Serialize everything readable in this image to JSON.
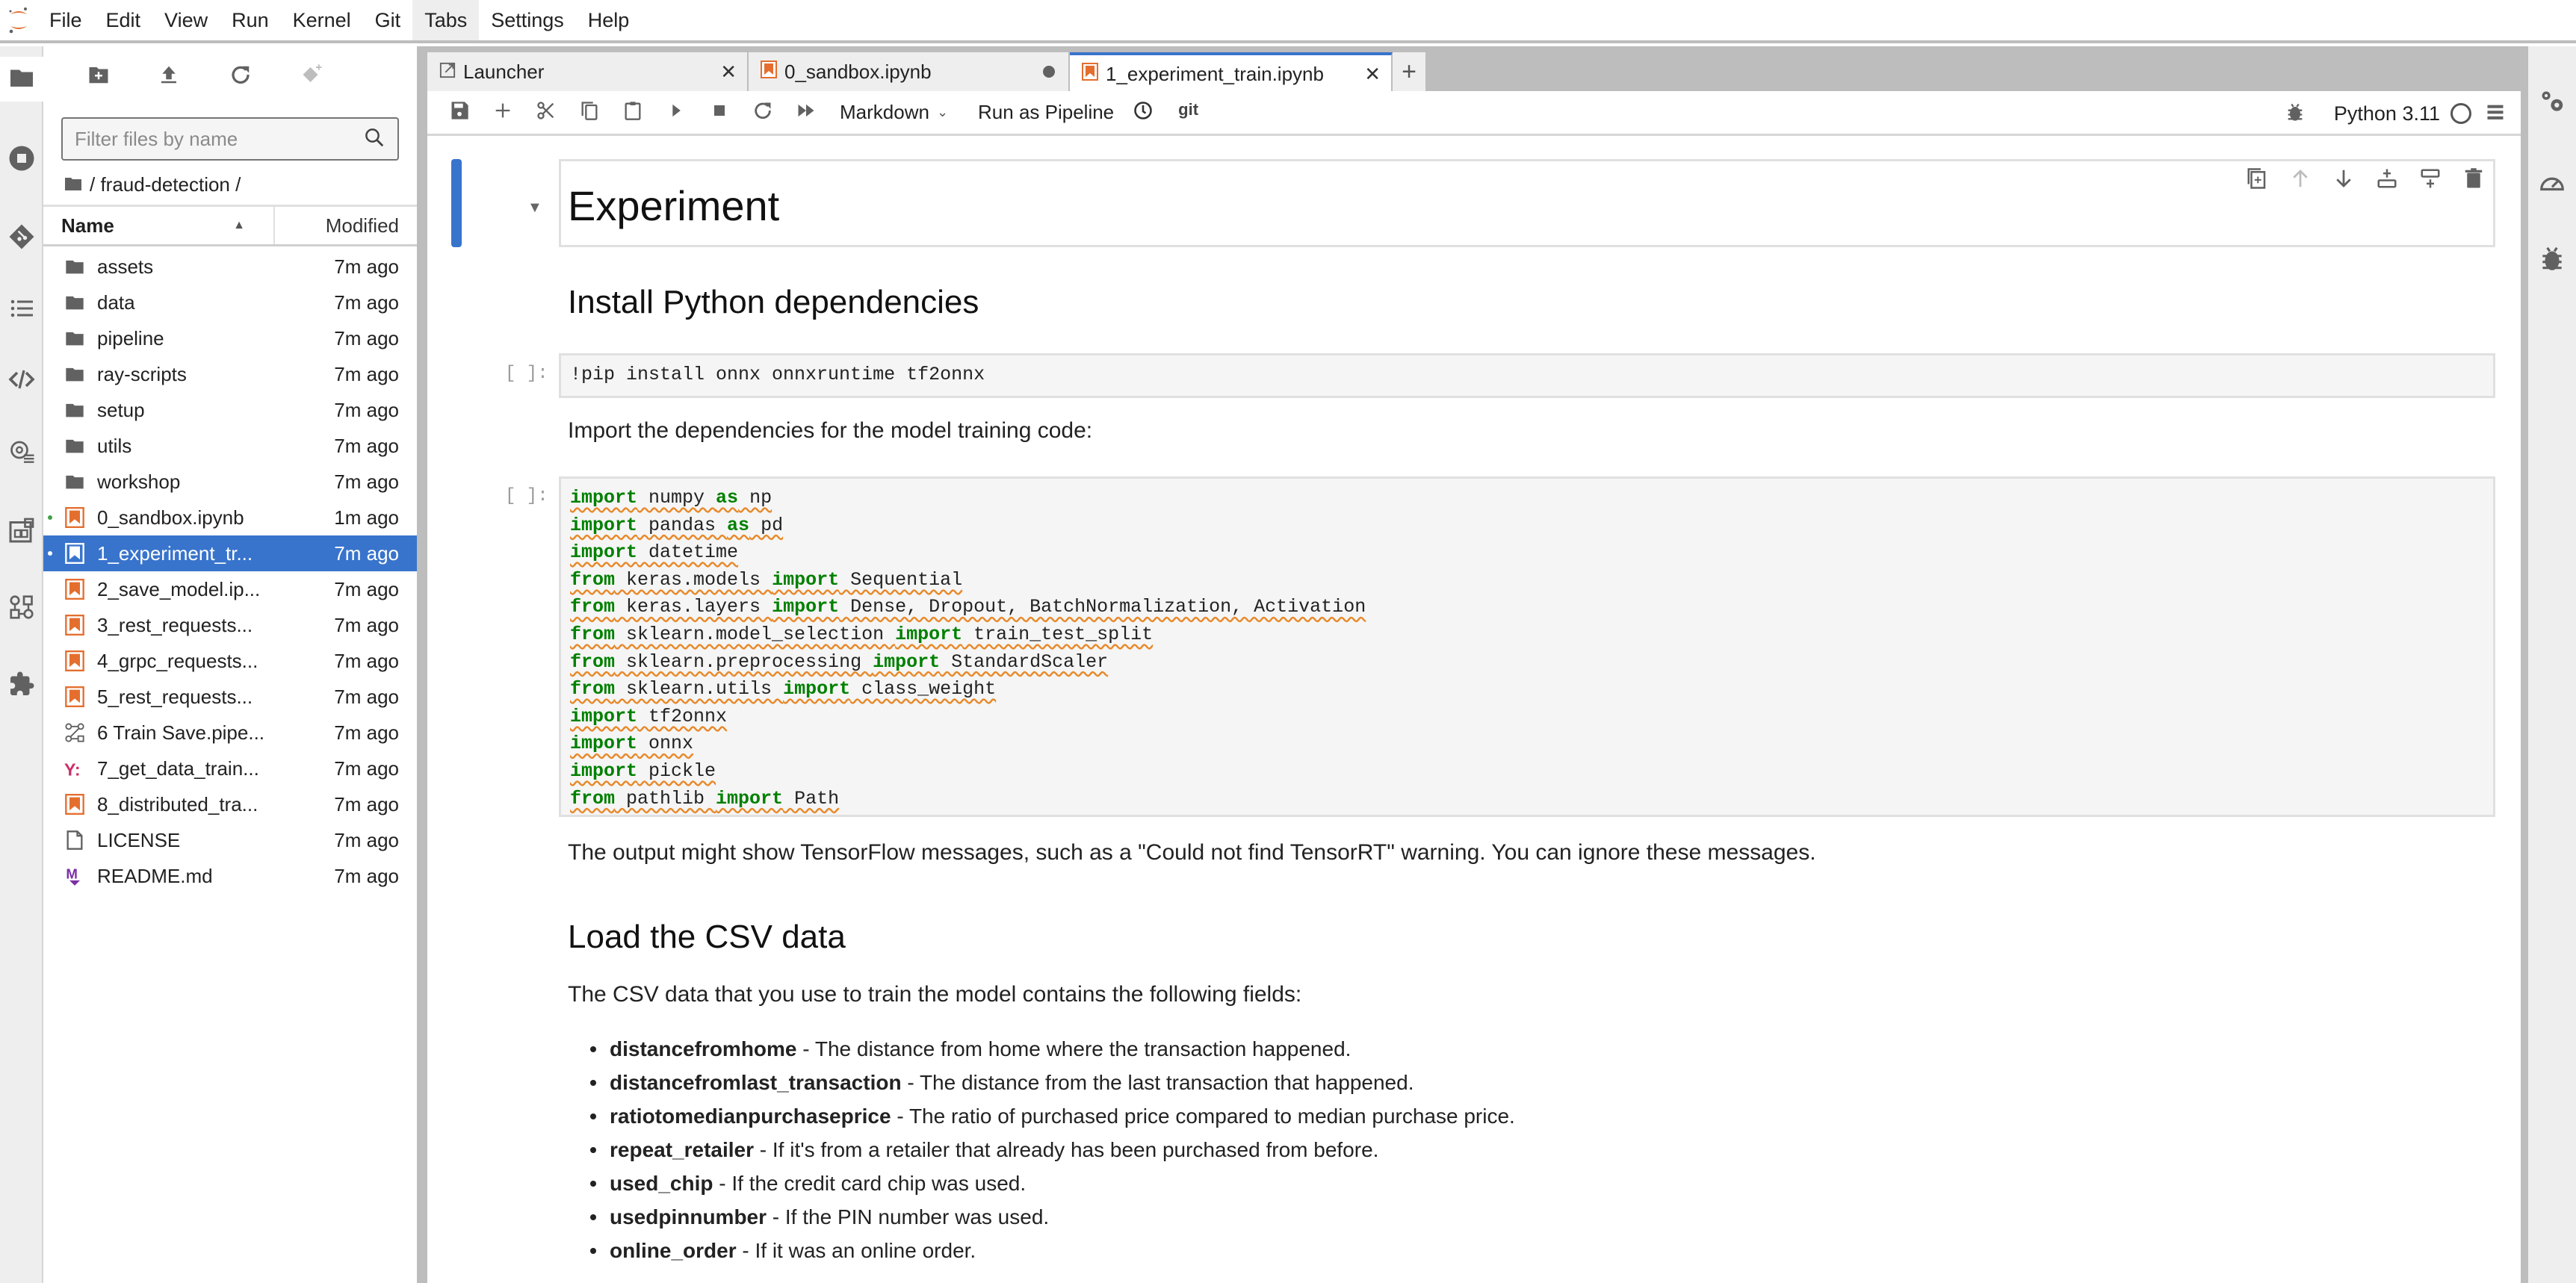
{
  "menubar": {
    "logo": "jupyter-logo",
    "items": [
      "File",
      "Edit",
      "View",
      "Run",
      "Kernel",
      "Git",
      "Tabs",
      "Settings",
      "Help"
    ],
    "active_item": "Tabs"
  },
  "activity_bar": {
    "icons": [
      "folder-icon",
      "running-icon",
      "git-icon",
      "toc-icon",
      "code-snippet-icon",
      "property-inspector-icon",
      "palette-icon",
      "pipeline-icon",
      "extension-icon"
    ]
  },
  "file_browser": {
    "toolbar": [
      "new-folder-icon",
      "upload-icon",
      "refresh-icon",
      "git-clone-icon"
    ],
    "filter_placeholder": "Filter files by name",
    "filter_value": "",
    "breadcrumb": "/ fraud-detection /",
    "columns": {
      "name": "Name",
      "modified": "Modified"
    },
    "files": [
      {
        "name": "assets",
        "type": "folder",
        "modified": "7m ago"
      },
      {
        "name": "data",
        "type": "folder",
        "modified": "7m ago"
      },
      {
        "name": "pipeline",
        "type": "folder",
        "modified": "7m ago"
      },
      {
        "name": "ray-scripts",
        "type": "folder",
        "modified": "7m ago"
      },
      {
        "name": "setup",
        "type": "folder",
        "modified": "7m ago"
      },
      {
        "name": "utils",
        "type": "folder",
        "modified": "7m ago"
      },
      {
        "name": "workshop",
        "type": "folder",
        "modified": "7m ago"
      },
      {
        "name": "0_sandbox.ipynb",
        "type": "notebook",
        "modified": "1m ago",
        "running": true
      },
      {
        "name": "1_experiment_tr...",
        "type": "notebook",
        "modified": "7m ago",
        "running": true,
        "selected": true
      },
      {
        "name": "2_save_model.ip...",
        "type": "notebook",
        "modified": "7m ago"
      },
      {
        "name": "3_rest_requests...",
        "type": "notebook",
        "modified": "7m ago"
      },
      {
        "name": "4_grpc_requests...",
        "type": "notebook",
        "modified": "7m ago"
      },
      {
        "name": "5_rest_requests...",
        "type": "notebook",
        "modified": "7m ago"
      },
      {
        "name": "6 Train Save.pipe...",
        "type": "pipeline",
        "modified": "7m ago"
      },
      {
        "name": "7_get_data_train...",
        "type": "yaml",
        "modified": "7m ago"
      },
      {
        "name": "8_distributed_tra...",
        "type": "notebook",
        "modified": "7m ago"
      },
      {
        "name": "LICENSE",
        "type": "file",
        "modified": "7m ago"
      },
      {
        "name": "README.md",
        "type": "markdown",
        "modified": "7m ago"
      }
    ]
  },
  "tabs": [
    {
      "label": "Launcher",
      "icon": "launcher-icon",
      "state": "close"
    },
    {
      "label": "0_sandbox.ipynb",
      "icon": "notebook-icon",
      "state": "dirty"
    },
    {
      "label": "1_experiment_train.ipynb",
      "icon": "notebook-icon",
      "state": "close",
      "active": true
    }
  ],
  "notebook_toolbar": {
    "cell_type": "Markdown",
    "run_pipeline_label": "Run as Pipeline",
    "git_label": "git",
    "kernel_name": "Python 3.11"
  },
  "notebook": {
    "h1": "Experiment",
    "h2_install": "Install Python dependencies",
    "prompt": "[ ]:",
    "pip_cell": "!pip install onnx onnxruntime tf2onnx",
    "import_text": "Import the dependencies for the model training code:",
    "code_lines": [
      [
        [
          "kw",
          "import"
        ],
        [
          "t",
          " numpy "
        ],
        [
          "kw",
          "as"
        ],
        [
          "t",
          " np"
        ]
      ],
      [
        [
          "kw",
          "import"
        ],
        [
          "t",
          " pandas "
        ],
        [
          "kw",
          "as"
        ],
        [
          "t",
          " pd"
        ]
      ],
      [
        [
          "kw",
          "import"
        ],
        [
          "t",
          " datetime"
        ]
      ],
      [
        [
          "kw",
          "from"
        ],
        [
          "t",
          " keras.models "
        ],
        [
          "kw",
          "import"
        ],
        [
          "t",
          " Sequential"
        ]
      ],
      [
        [
          "kw",
          "from"
        ],
        [
          "t",
          " keras.layers "
        ],
        [
          "kw",
          "import"
        ],
        [
          "t",
          " Dense, Dropout, BatchNormalization, Activation"
        ]
      ],
      [
        [
          "kw",
          "from"
        ],
        [
          "t",
          " sklearn.model_selection "
        ],
        [
          "kw",
          "import"
        ],
        [
          "t",
          " train_test_split"
        ]
      ],
      [
        [
          "kw",
          "from"
        ],
        [
          "t",
          " sklearn.preprocessing "
        ],
        [
          "kw",
          "import"
        ],
        [
          "t",
          " StandardScaler"
        ]
      ],
      [
        [
          "kw",
          "from"
        ],
        [
          "t",
          " sklearn.utils "
        ],
        [
          "kw",
          "import"
        ],
        [
          "t",
          " class_weight"
        ]
      ],
      [
        [
          "kw",
          "import"
        ],
        [
          "t",
          " tf2onnx"
        ]
      ],
      [
        [
          "kw",
          "import"
        ],
        [
          "t",
          " onnx"
        ]
      ],
      [
        [
          "kw",
          "import"
        ],
        [
          "t",
          " pickle"
        ]
      ],
      [
        [
          "kw",
          "from"
        ],
        [
          "t",
          " pathlib "
        ],
        [
          "kw",
          "import"
        ],
        [
          "t",
          " Path"
        ]
      ]
    ],
    "tf_note": "The output might show TensorFlow messages, such as a \"Could not find TensorRT\" warning. You can ignore these messages.",
    "h2_csv": "Load the CSV data",
    "csv_intro": "The CSV data that you use to train the model contains the following fields:",
    "fields": [
      {
        "name": "distancefromhome",
        "desc": " - The distance from home where the transaction happened."
      },
      {
        "name": "distancefromlast_transaction",
        "desc": " - The distance from the last transaction that happened."
      },
      {
        "name": "ratiotomedianpurchaseprice",
        "desc": " - The ratio of purchased price compared to median purchase price."
      },
      {
        "name": "repeat_retailer",
        "desc": " - If it's from a retailer that already has been purchased from before."
      },
      {
        "name": "used_chip",
        "desc": " - If the credit card chip was used."
      },
      {
        "name": "usedpinnumber",
        "desc": " - If the PIN number was used."
      },
      {
        "name": "online_order",
        "desc": " - If it was an online order."
      }
    ]
  },
  "right_bar": {
    "icons": [
      "property-inspector-icon",
      "resource-usage-icon",
      "debugger-icon"
    ]
  },
  "colors": {
    "accent": "#3874cc",
    "notebook_icon": "#e46e2e",
    "keyword": "#008000",
    "yaml": "#cb2f6a",
    "markdown": "#7b2fa6"
  }
}
